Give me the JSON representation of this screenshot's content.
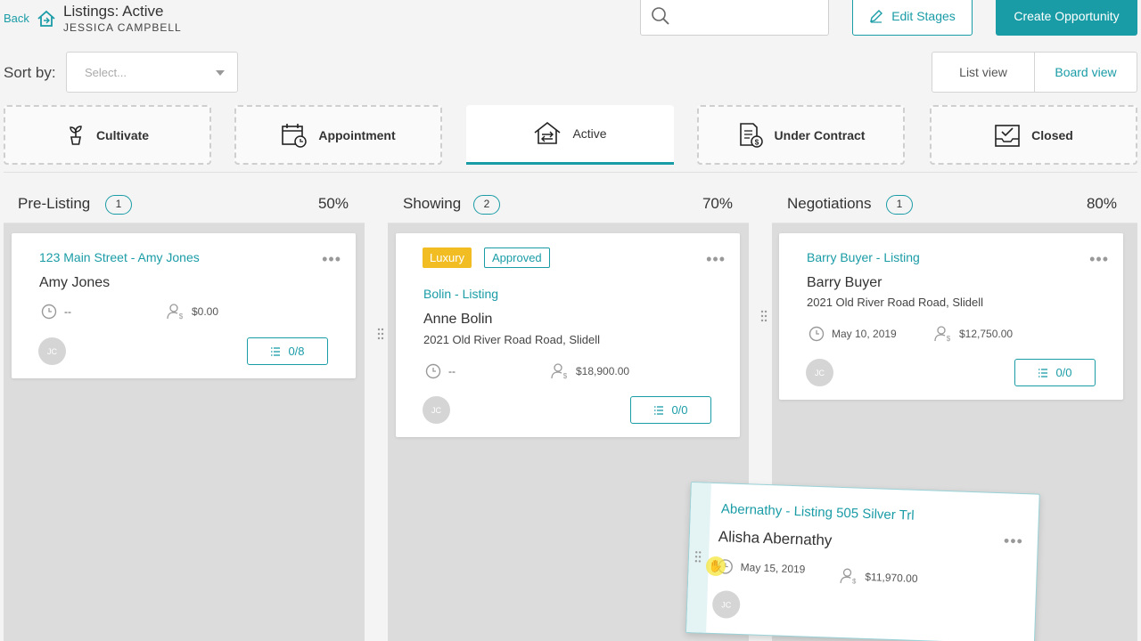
{
  "header": {
    "back": "Back",
    "title": "Listings: Active",
    "subtitle": "JESSICA CAMPBELL",
    "search_placeholder": "",
    "edit_stages": "Edit Stages",
    "create_opportunity": "Create Opportunity"
  },
  "sort": {
    "label": "Sort by:",
    "placeholder": "Select..."
  },
  "views": {
    "list": "List view",
    "board": "Board view",
    "selected": "Board view"
  },
  "stages": [
    {
      "label": "Cultivate",
      "icon": "plant-icon"
    },
    {
      "label": "Appointment",
      "icon": "calendar-clock-icon"
    },
    {
      "label": "Active",
      "icon": "house-arrows-icon",
      "active": true
    },
    {
      "label": "Under Contract",
      "icon": "contract-icon"
    },
    {
      "label": "Closed",
      "icon": "inbox-check-icon"
    }
  ],
  "columns": [
    {
      "title": "Pre-Listing",
      "count": "1",
      "percent": "50%",
      "cards": [
        {
          "title": "123 Main Street - Amy Jones",
          "name": "Amy Jones",
          "address": "",
          "date": "--",
          "amount": "$0.00",
          "avatar": "JC",
          "tasks": "0/8"
        }
      ]
    },
    {
      "title": "Showing",
      "count": "2",
      "percent": "70%",
      "cards": [
        {
          "badges": [
            "Luxury",
            "Approved"
          ],
          "title": "Bolin - Listing",
          "name": "Anne Bolin",
          "address": "2021 Old River Road Road, Slidell",
          "date": "--",
          "amount": "$18,900.00",
          "avatar": "JC",
          "tasks": "0/0"
        }
      ]
    },
    {
      "title": "Negotiations",
      "count": "1",
      "percent": "80%",
      "cards": [
        {
          "title": "Barry Buyer - Listing",
          "name": "Barry Buyer",
          "address": "2021 Old River Road Road, Slidell",
          "date": "May 10, 2019",
          "amount": "$12,750.00",
          "avatar": "JC",
          "tasks": "0/0"
        }
      ]
    }
  ],
  "dragging_card": {
    "title": "Abernathy - Listing 505 Silver Trl",
    "name": "Alisha Abernathy",
    "date": "May 15, 2019",
    "amount": "$11,970.00",
    "avatar": "JC"
  },
  "colors": {
    "accent": "#1a9ca6",
    "luxury": "#f2bd22"
  }
}
